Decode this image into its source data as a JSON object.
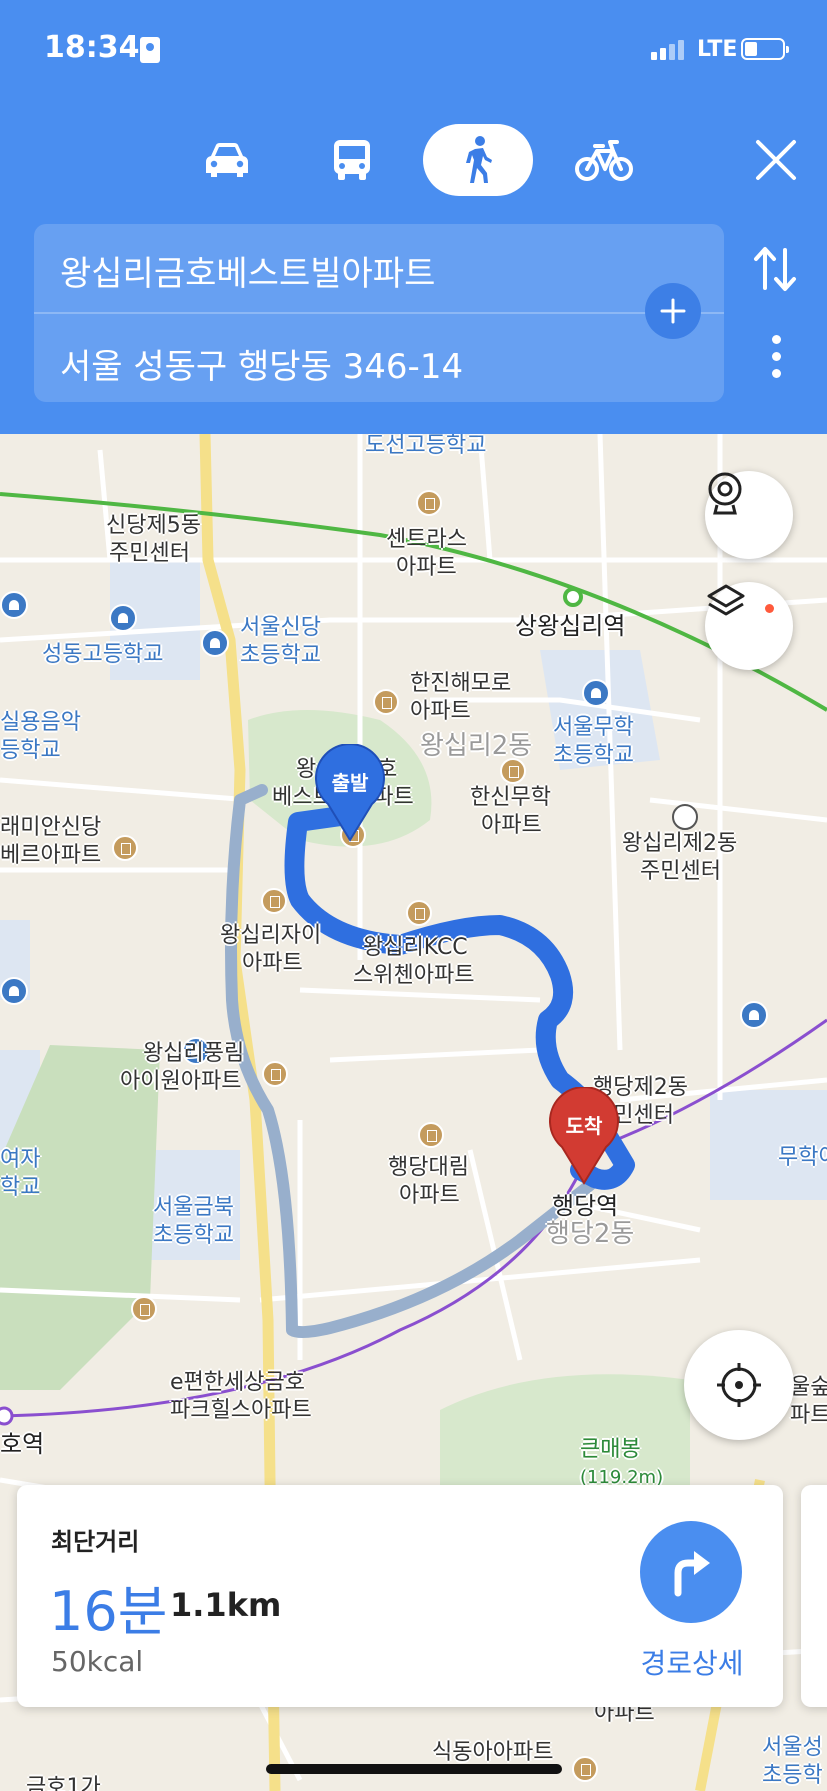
{
  "status_bar": {
    "time": "18:34",
    "network": "LTE"
  },
  "transport_modes": [
    {
      "id": "car",
      "icon": "car-icon"
    },
    {
      "id": "bus",
      "icon": "bus-icon"
    },
    {
      "id": "walk",
      "icon": "walk-icon",
      "selected": true
    },
    {
      "id": "bike",
      "icon": "bike-icon"
    }
  ],
  "route": {
    "origin": "왕십리금호베스트빌아파트",
    "destination": "서울 성동구 행당동 346-14"
  },
  "map": {
    "labels": {
      "doseon_high": "도선고등학교",
      "sindang5": "신당제5동",
      "sindang5_b": "주민센터",
      "centras": "센트라스",
      "centras_b": "아파트",
      "sangwangsimni": "상왕십리역",
      "seongdong_high": "성동고등학교",
      "seoul_sindang": "서울신당",
      "seoul_sindang_b": "초등학교",
      "hanjin": "한진해모로",
      "hanjin_b": "아파트",
      "seoul_muhak": "서울무학",
      "seoul_muhak_b": "초등학교",
      "wangsimni2_area": "왕십리2동",
      "silyong": "실용음악",
      "silyong_b": "등학교",
      "raemian": "래미안신당",
      "raemian_b": "베르아파트",
      "origin_apt": "왕십리금호",
      "origin_apt_b": "베스트빌아파트",
      "hanshin": "한신무학",
      "hanshin_b": "아파트",
      "wangsimni2_center": "왕십리제2동",
      "wangsimni2_center_b": "주민센터",
      "wangsimni_i": "왕십리자이",
      "wangsimni_i_b": "아파트",
      "kcc": "왕십리KCC",
      "kcc_b": "스위첸아파트",
      "pungrim": "왕십리풍림",
      "pungrim_b": "아이원아파트",
      "haengdang2_center": "행당제2동",
      "haengdang2_center_b": "주민센터",
      "muhak_girls": "무학여",
      "yeoja": "여자",
      "yeoja_b": "학교",
      "haengdang_daerim": "행당대림",
      "haengdang_daerim_b": "아파트",
      "seoul_geumbuk": "서울금북",
      "seoul_geumbuk_b": "초등학교",
      "haengdang_station": "행당역",
      "haengdang2_area": "행당2동",
      "epyeonhan": "e편한세상금호",
      "epyeonhan_b": "파크힐스아파트",
      "geumho_station": "호역",
      "keunmaebong": "큰매봉",
      "keunmaebong_b": "(119.2m)",
      "ulsup": "울숲",
      "ulsup_b": "파트",
      "sikdong": "식동아아파트",
      "seoul_right": "서울성",
      "seoul_right_b": "초등학",
      "hapt": "아파트",
      "geumho1": "금호1가"
    },
    "start_pin": "출발",
    "end_pin": "도착",
    "route_color": "#2f6fe0",
    "alt_route_color": "#98afcc",
    "subway_line2_color": "#4fb743",
    "subway_line5_color": "#8a4fcf"
  },
  "summary": {
    "title": "최단거리",
    "time": "16분",
    "distance": "1.1km",
    "calories": "50kcal",
    "detail_label": "경로상세"
  },
  "colors": {
    "header": "#4a8ef0",
    "accent": "#3b7de6"
  }
}
